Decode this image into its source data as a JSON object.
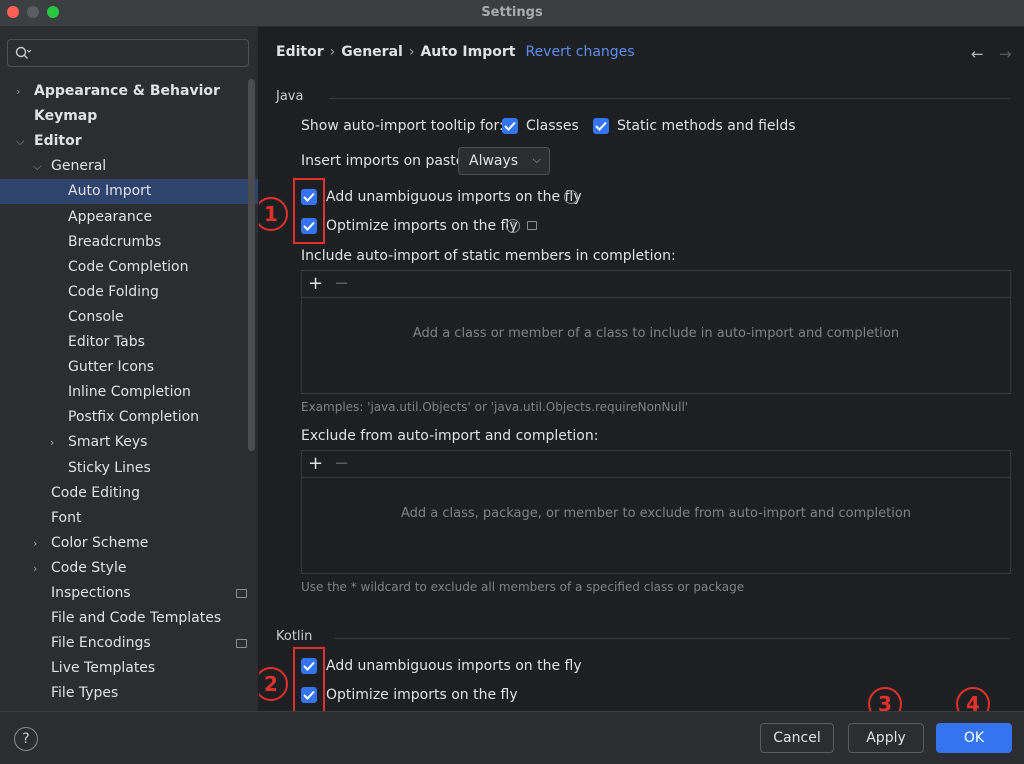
{
  "window": {
    "title": "Settings",
    "controls": [
      "#ff5f57",
      "#b4b6bb",
      "#28c840"
    ]
  },
  "sidebar": {
    "search_placeholder": "",
    "items": [
      {
        "label": "Appearance & Behavior",
        "level": 0,
        "expandable": true,
        "expanded": false,
        "bold": true
      },
      {
        "label": "Keymap",
        "level": 0,
        "expandable": false,
        "bold": true
      },
      {
        "label": "Editor",
        "level": 0,
        "expandable": true,
        "expanded": true,
        "bold": true
      },
      {
        "label": "General",
        "level": 1,
        "expandable": true,
        "expanded": true
      },
      {
        "label": "Auto Import",
        "level": 2,
        "selected": true
      },
      {
        "label": "Appearance",
        "level": 2
      },
      {
        "label": "Breadcrumbs",
        "level": 2
      },
      {
        "label": "Code Completion",
        "level": 2
      },
      {
        "label": "Code Folding",
        "level": 2
      },
      {
        "label": "Console",
        "level": 2
      },
      {
        "label": "Editor Tabs",
        "level": 2
      },
      {
        "label": "Gutter Icons",
        "level": 2
      },
      {
        "label": "Inline Completion",
        "level": 2
      },
      {
        "label": "Postfix Completion",
        "level": 2
      },
      {
        "label": "Smart Keys",
        "level": 2,
        "expandable": true,
        "expanded": false
      },
      {
        "label": "Sticky Lines",
        "level": 2
      },
      {
        "label": "Code Editing",
        "level": 1
      },
      {
        "label": "Font",
        "level": 1
      },
      {
        "label": "Color Scheme",
        "level": 1,
        "expandable": true,
        "expanded": false
      },
      {
        "label": "Code Style",
        "level": 1,
        "expandable": true,
        "expanded": false
      },
      {
        "label": "Inspections",
        "level": 1,
        "badge": true
      },
      {
        "label": "File and Code Templates",
        "level": 1
      },
      {
        "label": "File Encodings",
        "level": 1,
        "badge": true
      },
      {
        "label": "Live Templates",
        "level": 1
      },
      {
        "label": "File Types",
        "level": 1
      }
    ]
  },
  "breadcrumb": {
    "items": [
      "Editor",
      "General",
      "Auto Import"
    ],
    "revert": "Revert changes"
  },
  "java": {
    "title": "Java",
    "tooltip_label": "Show auto-import tooltip for:",
    "classes_label": "Classes",
    "static_label": "Static methods and fields",
    "paste_label": "Insert imports on paste:",
    "paste_value": "Always",
    "unambiguous_label": "Add unambiguous imports on the fly",
    "optimize_label": "Optimize imports on the fly",
    "include_label": "Include auto-import of static members in completion:",
    "include_empty": "Add a class or member of a class to include in auto-import and completion",
    "include_hint": "Examples: 'java.util.Objects' or 'java.util.Objects.requireNonNull'",
    "exclude_label": "Exclude from auto-import and completion:",
    "exclude_empty": "Add a class, package, or member to exclude from auto-import and completion",
    "exclude_hint": "Use the * wildcard to exclude all members of a specified class or package"
  },
  "kotlin": {
    "title": "Kotlin",
    "unambiguous_label": "Add unambiguous imports on the fly",
    "optimize_label": "Optimize imports on the fly"
  },
  "annotations": {
    "n1": "1",
    "n2": "2",
    "n3": "3",
    "n4": "4"
  },
  "footer": {
    "help": "?",
    "cancel": "Cancel",
    "apply": "Apply",
    "ok": "OK"
  },
  "colors": {
    "accent": "#3574f0",
    "annotation": "#e0322a",
    "selection": "#2e436e"
  }
}
